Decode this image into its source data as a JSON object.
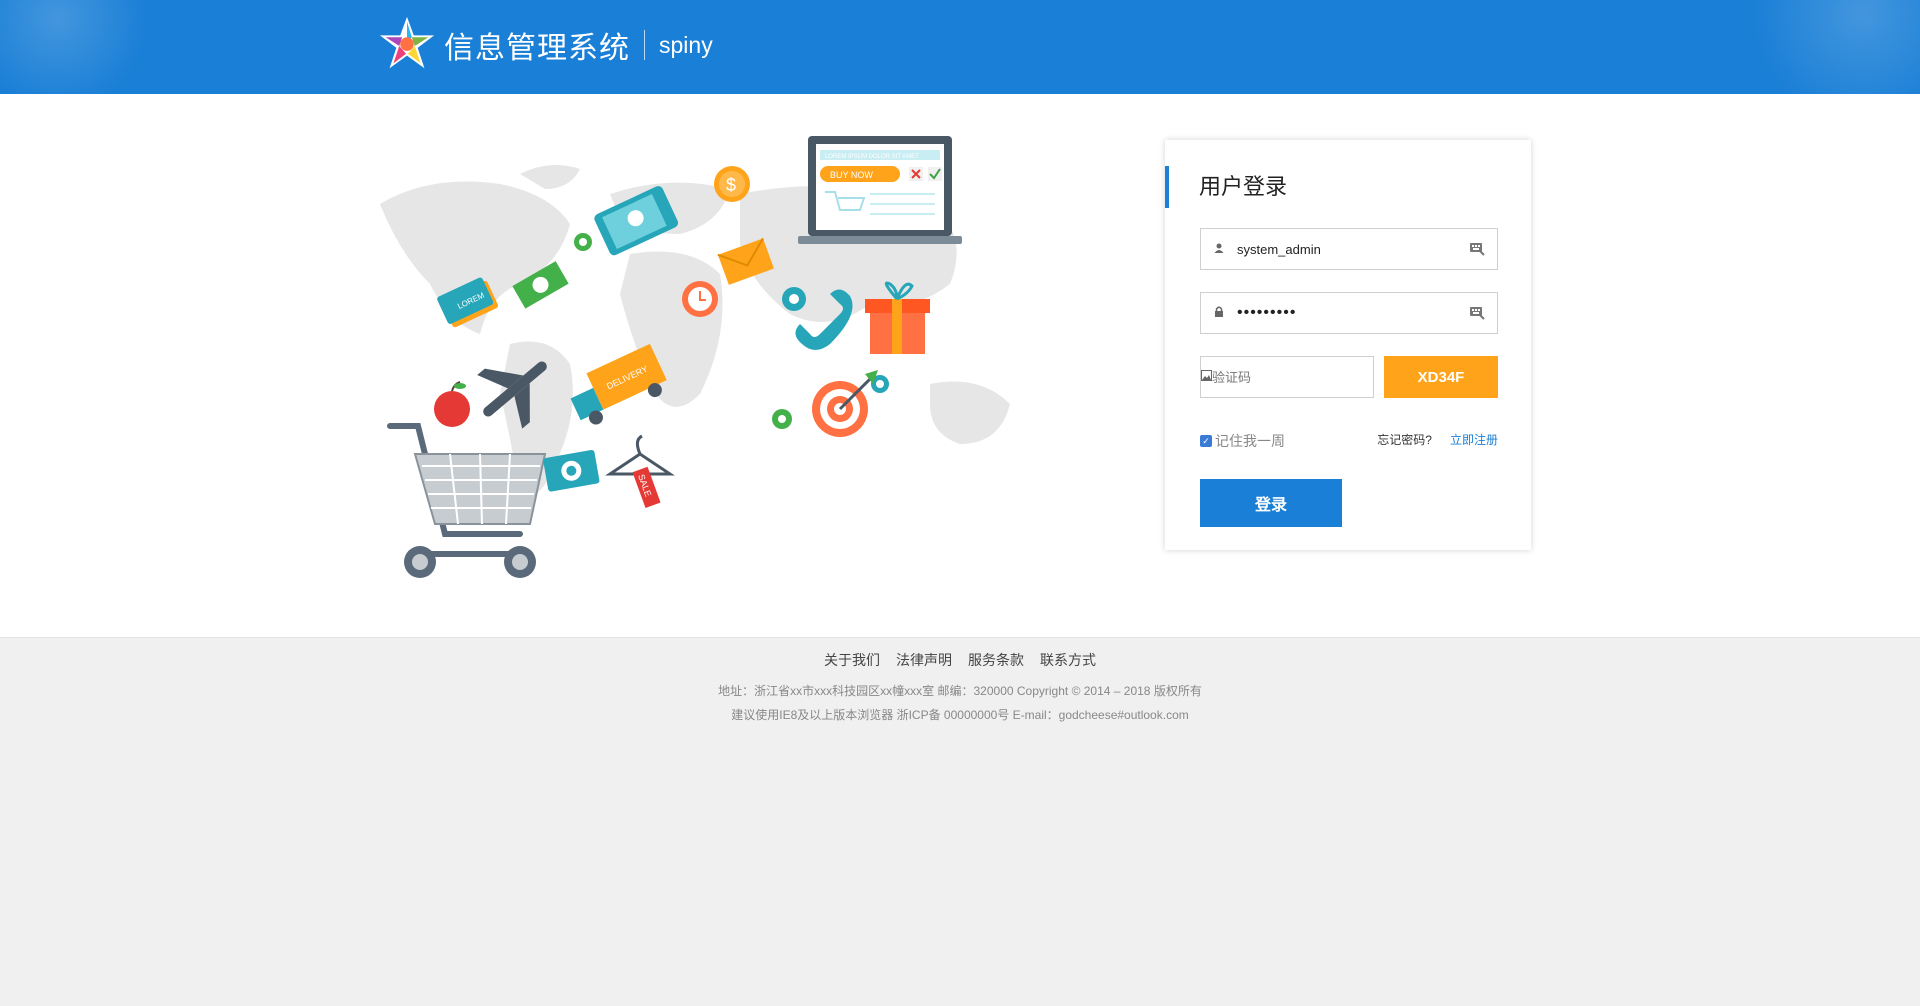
{
  "header": {
    "title": "信息管理系统",
    "subtitle": "spiny"
  },
  "illustration": {
    "laptop_banner": "LOREM IPSUM DOLOR SIT AMET",
    "buy_now": "BUY NOW",
    "coupon_text": "LOREM",
    "delivery_text": "DELIVERY",
    "sale_text": "SALE",
    "dollar_symbol": "$"
  },
  "login": {
    "title": "用户登录",
    "username_value": "system_admin",
    "password_value": "•••••••••",
    "captcha_placeholder": "验证码",
    "captcha_code": "XD34F",
    "remember_label": "记住我一周",
    "remember_checked": true,
    "forgot_label": "忘记密码?",
    "register_label": "立即注册",
    "submit_label": "登录"
  },
  "footer": {
    "links": [
      "关于我们",
      "法律声明",
      "服务条款",
      "联系方式"
    ],
    "address_line": "地址：浙江省xx市xxx科技园区xx幢xxx室 邮编：320000  Copyright © 2014 – 2018  版权所有",
    "icp_line": "建议使用IE8及以上版本浏览器 浙ICP备 00000000号 E-mail：godcheese#outlook.com"
  },
  "colors": {
    "primary": "#1a7fd6",
    "captcha_bg": "#ffa31a",
    "page_bg": "#f0f0f0"
  }
}
